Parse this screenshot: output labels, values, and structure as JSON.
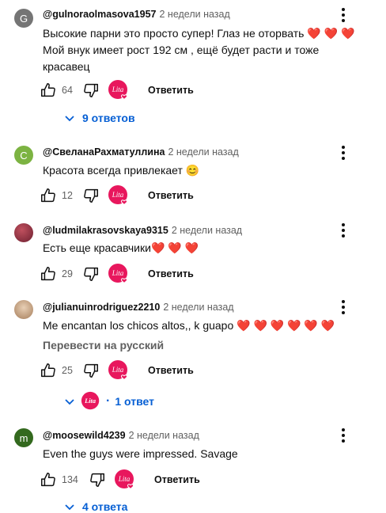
{
  "comments": [
    {
      "initial": "G",
      "avatar_color": "#757575",
      "author": "@gulnoraolmasova1957",
      "time": "2 недели назад",
      "lines": [
        "Высокие парни это просто супер! Глаз не оторвать ❤️ ❤️ ❤️",
        "Мой внук имеет рост 192 см , ещё будет расти  и тоже",
        "красавец"
      ],
      "likes": "64",
      "reply_label": "Ответить",
      "replies_label": "9 ответов"
    },
    {
      "initial": "С",
      "avatar_color": "#7cb342",
      "author": "@СвеланаРахматуллина",
      "time": "2 недели назад",
      "lines": [
        "Красота всегда привлекает 😊"
      ],
      "likes": "12",
      "reply_label": "Ответить"
    },
    {
      "initial": "",
      "avatar_color": "#8d3b4a",
      "author": "@ludmilakrasovskaya9315",
      "time": "2 недели назад",
      "lines": [
        "Есть еще красавчики❤️ ❤️ ❤️"
      ],
      "likes": "29",
      "reply_label": "Ответить"
    },
    {
      "initial": "",
      "avatar_color": "#c9a27e",
      "author": "@julianuinrodriguez2210",
      "time": "2 недели назад",
      "lines": [
        "Me encantan los chicos altos,, k guapo ❤️ ❤️ ❤️ ❤️ ❤️ ❤️"
      ],
      "translate_label": "Перевести на русский",
      "likes": "25",
      "reply_label": "Ответить",
      "replies_label": "1 ответ"
    },
    {
      "initial": "m",
      "avatar_color": "#33691e",
      "author": "@moosewild4239",
      "time": "2 недели назад",
      "lines": [
        "Even the guys were impressed. Savage"
      ],
      "likes": "134",
      "reply_label": "Ответить",
      "replies_label": "4 ответа"
    }
  ],
  "creator_logo_text": "Lita",
  "colors": {
    "link": "#065fd4",
    "meta": "#606060",
    "creator": "#e8175d"
  }
}
